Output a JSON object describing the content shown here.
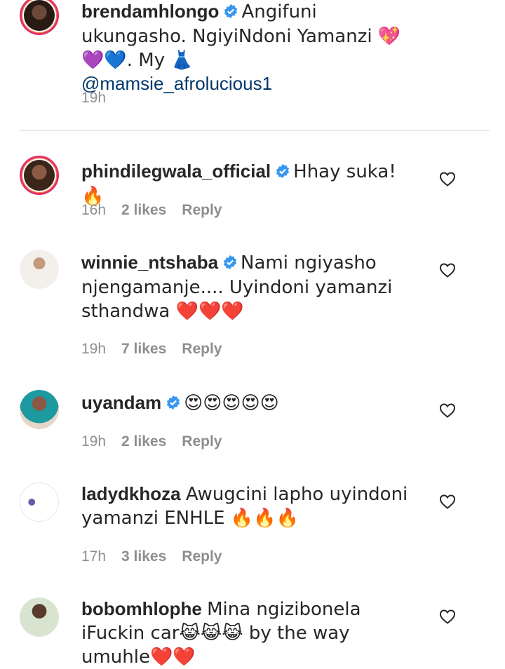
{
  "caption": {
    "username": "brendamhlongo",
    "text": "Angifuni ukungasho. NgiyiNdoni Yamanzi 💖💜💙. My 👗",
    "mention": "@mamsie_afrolucious1",
    "time": "19h"
  },
  "comments": [
    {
      "username": "phindilegwala_official",
      "text": "Hhay suka! 🔥",
      "time": "16h",
      "likes": "2 likes",
      "reply": "Reply"
    },
    {
      "username": "winnie_ntshaba",
      "text": "Nami ngiyasho njengamanje.... Uyindoni yamanzi sthandwa ❤️❤️❤️",
      "time": "19h",
      "likes": "7 likes",
      "reply": "Reply"
    },
    {
      "username": "uyandam",
      "text": "😍😍😍😍😍",
      "time": "19h",
      "likes": "2 likes",
      "reply": "Reply"
    },
    {
      "username": "ladydkhoza",
      "text": "Awugcini lapho uyindoni yamanzi ENHLE 🔥🔥🔥",
      "time": "17h",
      "likes": "3 likes",
      "reply": "Reply"
    },
    {
      "username": "bobomhlophe",
      "text": "Mina ngizibonela iFuckin car😹😹😹 by the way umuhle❤️❤️"
    }
  ],
  "colors": {
    "verified": "#3897f0",
    "meta": "#8e8e8e",
    "mention": "#00376b",
    "story_ring": "#e1306c"
  },
  "icons": {
    "heart": "heart-outline-icon",
    "verified": "verified-badge-icon"
  }
}
